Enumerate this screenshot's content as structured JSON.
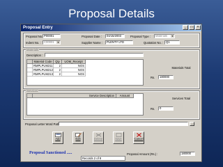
{
  "slide": {
    "title": "Proposal Details"
  },
  "window": {
    "title": "Proposal Entry",
    "min": "_",
    "max": "□",
    "close": "×"
  },
  "header": {
    "proposal_no_label": "Proposal No. :",
    "proposal_no": "P00001",
    "indent_no_label": "Indent No. :",
    "indent_no": "C00001",
    "proposal_date_label": "Proposal Date :",
    "proposal_date": "04/15/2003",
    "supplier_name_label": "Supplier Name :",
    "supplier_name": "PLENTY LTD",
    "proposal_type_label": "Proposal Type :",
    "proposal_type": "Materials",
    "quotation_no_label": "Quotation No. :",
    "quotation_no": "Q1"
  },
  "materials": {
    "group_title": "Materials",
    "description_label": "Description :",
    "description": "",
    "columns": [
      "Material Code",
      "Qty",
      "UOM_Receipt"
    ],
    "rows": [
      [
        "RMPLPUM211",
        "2",
        "NOS"
      ],
      [
        "RMPLPUM212",
        "2",
        "NOS"
      ],
      [
        "RMPLPUM213",
        "2",
        "NOS"
      ]
    ],
    "total_label": "Materials Total",
    "rs_label": "Rs.",
    "total": "180000"
  },
  "services": {
    "group_title": "Services",
    "columns": [
      "Service Description",
      "Amount"
    ],
    "total_label": "Services Total",
    "rs_label": "Rs.",
    "total": "0"
  },
  "letter": {
    "label": "Proposal Letter Word Path :",
    "path": "",
    "browse": "..."
  },
  "status_text": "Proposal Sanctioned .....",
  "amount": {
    "label": "Proposal Amount (Rs.) :",
    "value": "180000"
  },
  "buttons": {
    "add": "Add",
    "edit": "Edit",
    "delete": "Delete",
    "save": "Save",
    "cancel": "Cancel"
  },
  "record": "Records 2 of 8"
}
